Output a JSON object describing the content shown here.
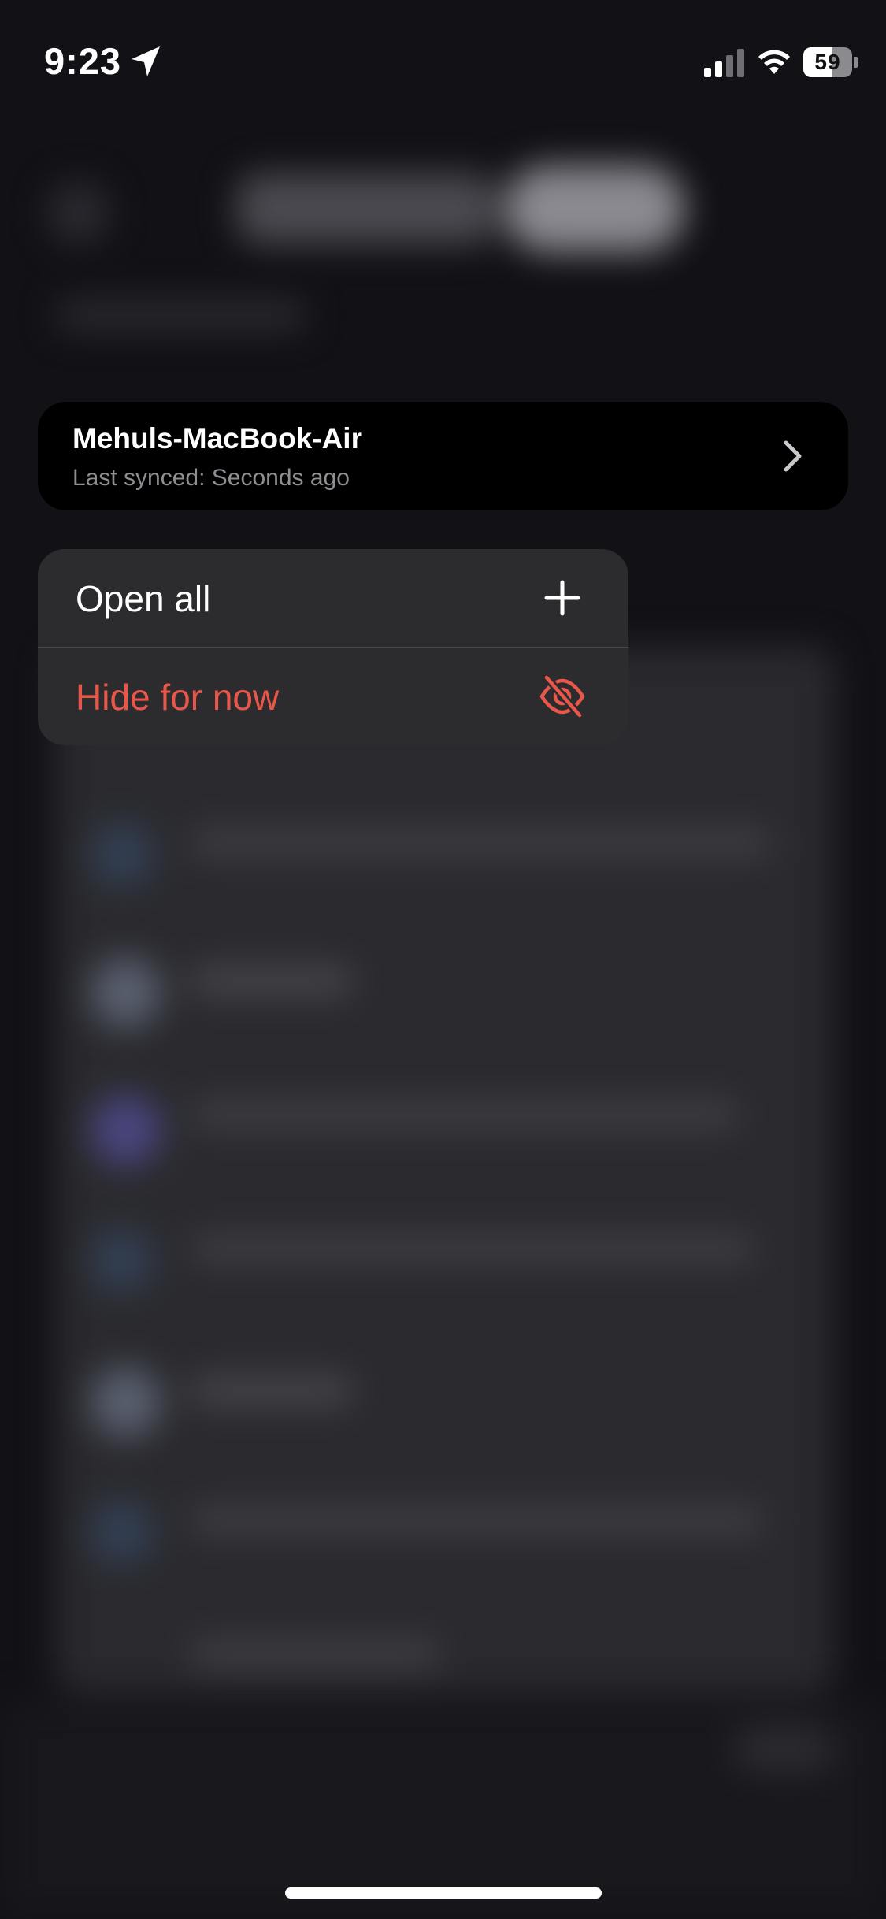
{
  "status_bar": {
    "time": "9:23",
    "battery": "59",
    "battery_percent": 59
  },
  "device_card": {
    "name": "Mehuls-MacBook-Air",
    "last_synced": "Last synced: Seconds ago"
  },
  "menu": {
    "items": [
      {
        "label": "Open all",
        "icon": "plus-icon",
        "color": "#ffffff"
      },
      {
        "label": "Hide for now",
        "icon": "eye-slash-icon",
        "color": "#e9574a"
      }
    ]
  },
  "colors": {
    "background": "#111116",
    "menu": "#2c2c2e",
    "destructive": "#e9574a"
  }
}
